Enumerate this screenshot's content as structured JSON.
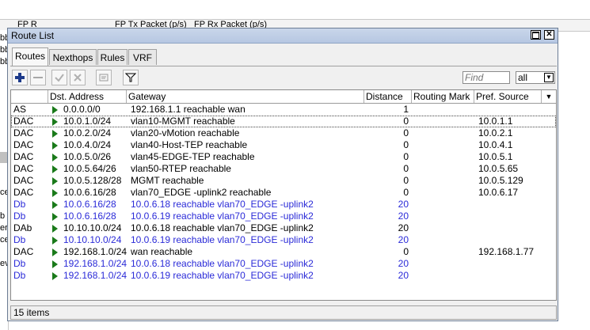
{
  "background": {
    "header_labels": [
      "FP R",
      "FP Tx Packet (p/s)",
      "FP Rx Packet (p/s)"
    ],
    "left_fragments": [
      "bb",
      "bb",
      "bb",
      "",
      "",
      "",
      "",
      "",
      "",
      "",
      "",
      "",
      "",
      "ce",
      "",
      "b",
      "er",
      "cer",
      "",
      "ev"
    ]
  },
  "window": {
    "title": "Route List",
    "maximize_icon": "maximize-icon",
    "close_icon": "close-icon"
  },
  "tabs": [
    "Routes",
    "Nexthops",
    "Rules",
    "VRF"
  ],
  "toolbar": {
    "icons": [
      "plus-icon",
      "minus-icon",
      "check-icon",
      "x-icon",
      "comment-icon",
      "filter-icon"
    ],
    "find_placeholder": "Find",
    "filter_value": "all"
  },
  "table": {
    "columns": [
      "",
      "Dst. Address",
      "Gateway",
      "Distance",
      "Routing Mark",
      "Pref. Source"
    ],
    "rows": [
      {
        "flags": "AS",
        "dst": "0.0.0.0/0",
        "gateway": "192.168.1.1 reachable wan",
        "distance": "1",
        "mark": "",
        "pref": "",
        "blue": false
      },
      {
        "flags": "DAC",
        "dst": "10.0.1.0/24",
        "gateway": "vlan10-MGMT reachable",
        "distance": "0",
        "mark": "",
        "pref": "10.0.1.1",
        "blue": false
      },
      {
        "flags": "DAC",
        "dst": "10.0.2.0/24",
        "gateway": "vlan20-vMotion reachable",
        "distance": "0",
        "mark": "",
        "pref": "10.0.2.1",
        "blue": false
      },
      {
        "flags": "DAC",
        "dst": "10.0.4.0/24",
        "gateway": "vlan40-Host-TEP reachable",
        "distance": "0",
        "mark": "",
        "pref": "10.0.4.1",
        "blue": false
      },
      {
        "flags": "DAC",
        "dst": "10.0.5.0/26",
        "gateway": "vlan45-EDGE-TEP reachable",
        "distance": "0",
        "mark": "",
        "pref": "10.0.5.1",
        "blue": false
      },
      {
        "flags": "DAC",
        "dst": "10.0.5.64/26",
        "gateway": "vlan50-RTEP reachable",
        "distance": "0",
        "mark": "",
        "pref": "10.0.5.65",
        "blue": false
      },
      {
        "flags": "DAC",
        "dst": "10.0.5.128/28",
        "gateway": "MGMT reachable",
        "distance": "0",
        "mark": "",
        "pref": "10.0.5.129",
        "blue": false
      },
      {
        "flags": "DAC",
        "dst": "10.0.6.16/28",
        "gateway": "vlan70_EDGE -uplink2 reachable",
        "distance": "0",
        "mark": "",
        "pref": "10.0.6.17",
        "blue": false
      },
      {
        "flags": "Db",
        "dst": "10.0.6.16/28",
        "gateway": "10.0.6.18 reachable vlan70_EDGE -uplink2",
        "distance": "20",
        "mark": "",
        "pref": "",
        "blue": true
      },
      {
        "flags": "Db",
        "dst": "10.0.6.16/28",
        "gateway": "10.0.6.19 reachable vlan70_EDGE -uplink2",
        "distance": "20",
        "mark": "",
        "pref": "",
        "blue": true
      },
      {
        "flags": "DAb",
        "dst": "10.10.10.0/24",
        "gateway": "10.0.6.18 reachable vlan70_EDGE -uplink2",
        "distance": "20",
        "mark": "",
        "pref": "",
        "blue": false
      },
      {
        "flags": "Db",
        "dst": "10.10.10.0/24",
        "gateway": "10.0.6.19 reachable vlan70_EDGE -uplink2",
        "distance": "20",
        "mark": "",
        "pref": "",
        "blue": true
      },
      {
        "flags": "DAC",
        "dst": "192.168.1.0/24",
        "gateway": "wan reachable",
        "distance": "0",
        "mark": "",
        "pref": "192.168.1.77",
        "blue": false
      },
      {
        "flags": "Db",
        "dst": "192.168.1.0/24",
        "gateway": "10.0.6.18 reachable vlan70_EDGE -uplink2",
        "distance": "20",
        "mark": "",
        "pref": "",
        "blue": true
      },
      {
        "flags": "Db",
        "dst": "192.168.1.0/24",
        "gateway": "10.0.6.19 reachable vlan70_EDGE -uplink2",
        "distance": "20",
        "mark": "",
        "pref": "",
        "blue": true
      }
    ]
  },
  "status": {
    "count": "15 items"
  },
  "colors": {
    "link_blue": "#2b2bd8",
    "arrow_green": "#1a7a1a",
    "titlebar": "#c9d6ea"
  }
}
